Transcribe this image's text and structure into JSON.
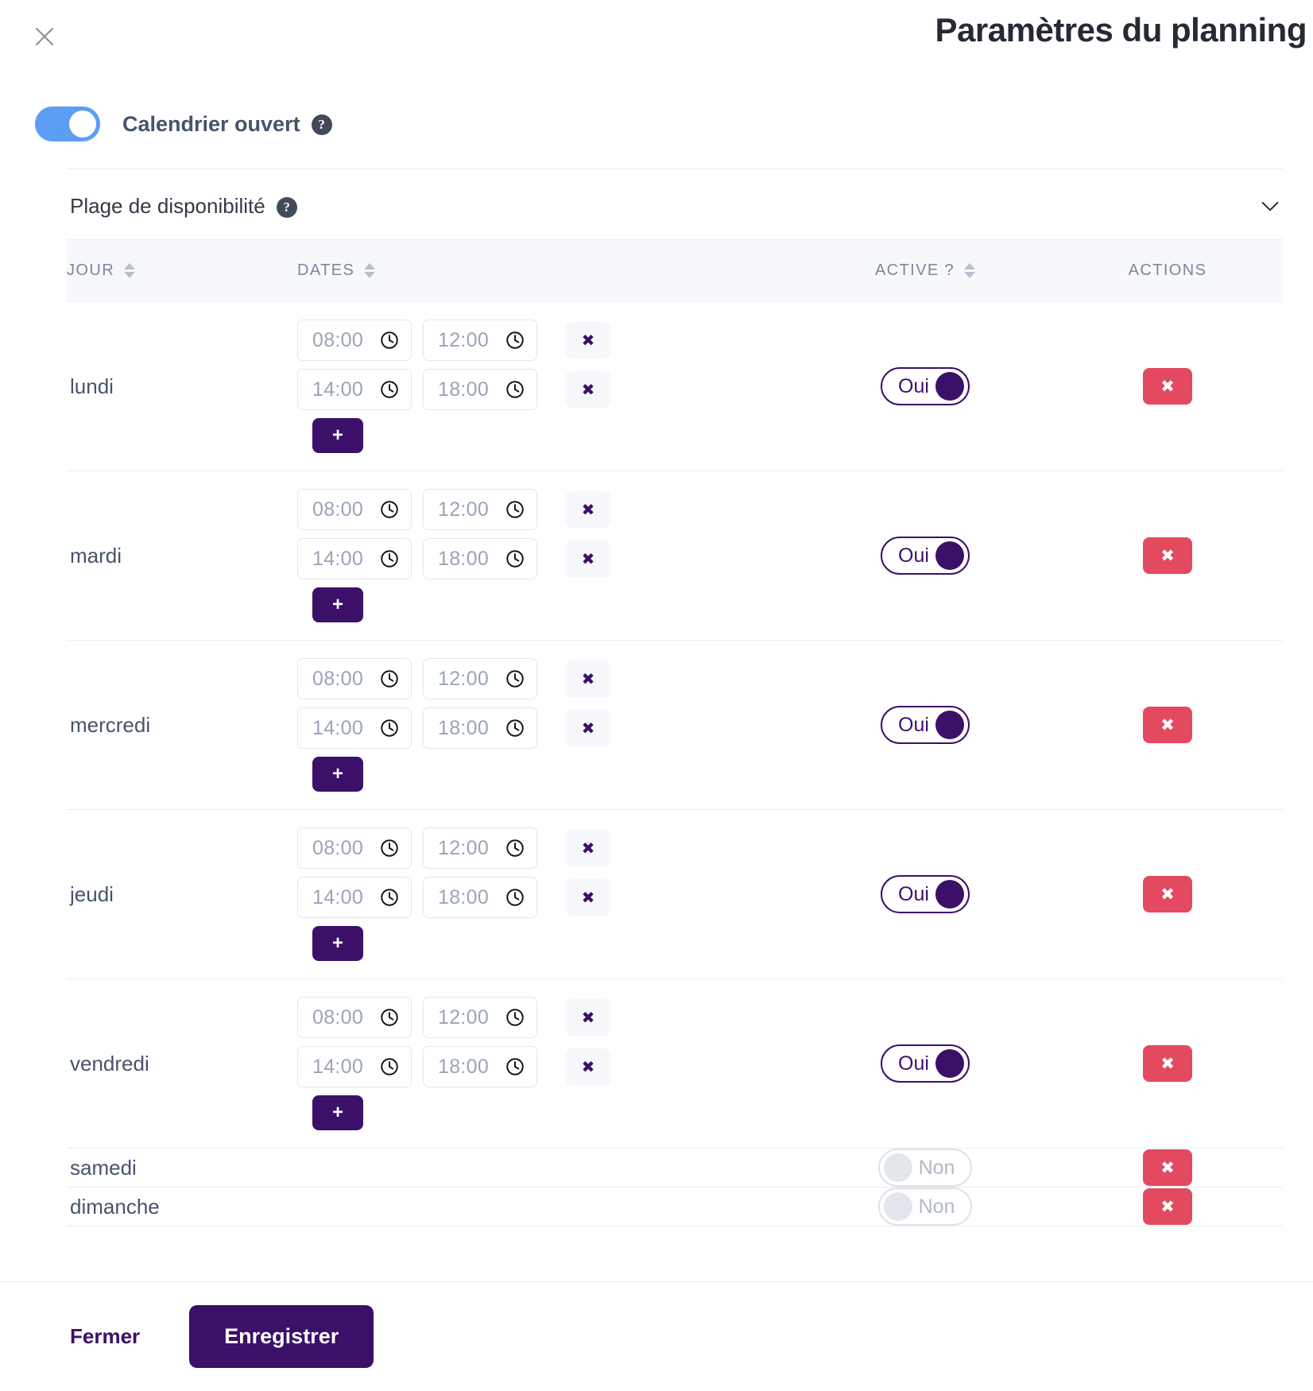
{
  "modal": {
    "title": "Paramètres du planning",
    "close_icon": "close-icon"
  },
  "calendar_switch": {
    "label": "Calendrier ouvert",
    "state": "on",
    "help_glyph": "?"
  },
  "availability_section": {
    "title": "Plage de disponibilité",
    "help_glyph": "?",
    "collapse_icon": "chevron-down-icon"
  },
  "table": {
    "columns": [
      {
        "label": "JOUR",
        "sortable": true
      },
      {
        "label": "DATES",
        "sortable": true
      },
      {
        "label": "ACTIVE ?",
        "sortable": true
      },
      {
        "label": "ACTIONS",
        "sortable": false
      }
    ],
    "add_slot_label": "+",
    "slot_remove_label": "✖",
    "row_delete_label": "✖",
    "rows": [
      {
        "day": "lundi",
        "slots": [
          {
            "start": "08:00",
            "end": "12:00"
          },
          {
            "start": "14:00",
            "end": "18:00"
          }
        ],
        "active": {
          "state": "on",
          "label": "Oui"
        }
      },
      {
        "day": "mardi",
        "slots": [
          {
            "start": "08:00",
            "end": "12:00"
          },
          {
            "start": "14:00",
            "end": "18:00"
          }
        ],
        "active": {
          "state": "on",
          "label": "Oui"
        }
      },
      {
        "day": "mercredi",
        "slots": [
          {
            "start": "08:00",
            "end": "12:00"
          },
          {
            "start": "14:00",
            "end": "18:00"
          }
        ],
        "active": {
          "state": "on",
          "label": "Oui"
        }
      },
      {
        "day": "jeudi",
        "slots": [
          {
            "start": "08:00",
            "end": "12:00"
          },
          {
            "start": "14:00",
            "end": "18:00"
          }
        ],
        "active": {
          "state": "on",
          "label": "Oui"
        }
      },
      {
        "day": "vendredi",
        "slots": [
          {
            "start": "08:00",
            "end": "12:00"
          },
          {
            "start": "14:00",
            "end": "18:00"
          }
        ],
        "active": {
          "state": "on",
          "label": "Oui"
        }
      },
      {
        "day": "samedi",
        "slots": [],
        "active": {
          "state": "off",
          "label": "Non"
        }
      },
      {
        "day": "dimanche",
        "slots": [],
        "active": {
          "state": "off",
          "label": "Non"
        }
      }
    ]
  },
  "footer": {
    "close_label": "Fermer",
    "save_label": "Enregistrer"
  },
  "colors": {
    "brand_purple": "#3b1068",
    "toggle_blue": "#5c9df5",
    "danger_red": "#e34a60",
    "header_bg": "#f7f8fb",
    "border": "#ececf1"
  }
}
